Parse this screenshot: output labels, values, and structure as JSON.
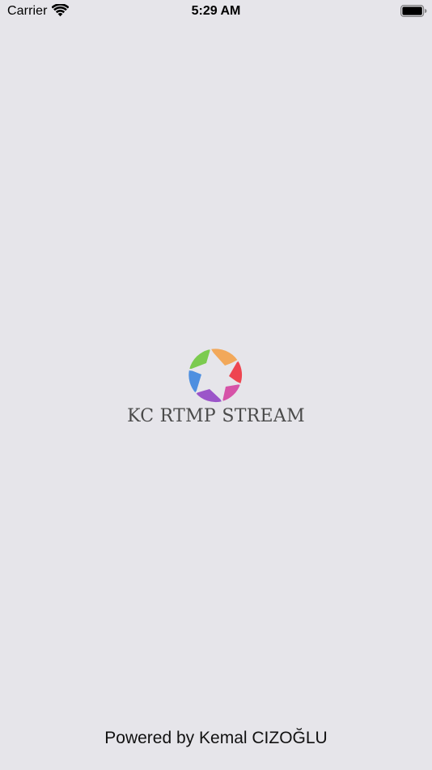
{
  "status_bar": {
    "carrier": "Carrier",
    "time": "5:29 AM",
    "wifi_icon": "wifi-icon",
    "battery_icon": "battery-icon"
  },
  "splash": {
    "logo_icon": "camera-shutter-icon",
    "app_name": "KC RTMP STREAM",
    "credit": "Powered by Kemal CIZOĞLU"
  },
  "colors": {
    "background": "#e6e5ea",
    "shutter_orange": "#f2a85a",
    "shutter_red": "#ee4550",
    "shutter_magenta": "#d653a8",
    "shutter_purple": "#9b55c9",
    "shutter_blue": "#4e8fe0",
    "shutter_green": "#7ccb4f"
  }
}
